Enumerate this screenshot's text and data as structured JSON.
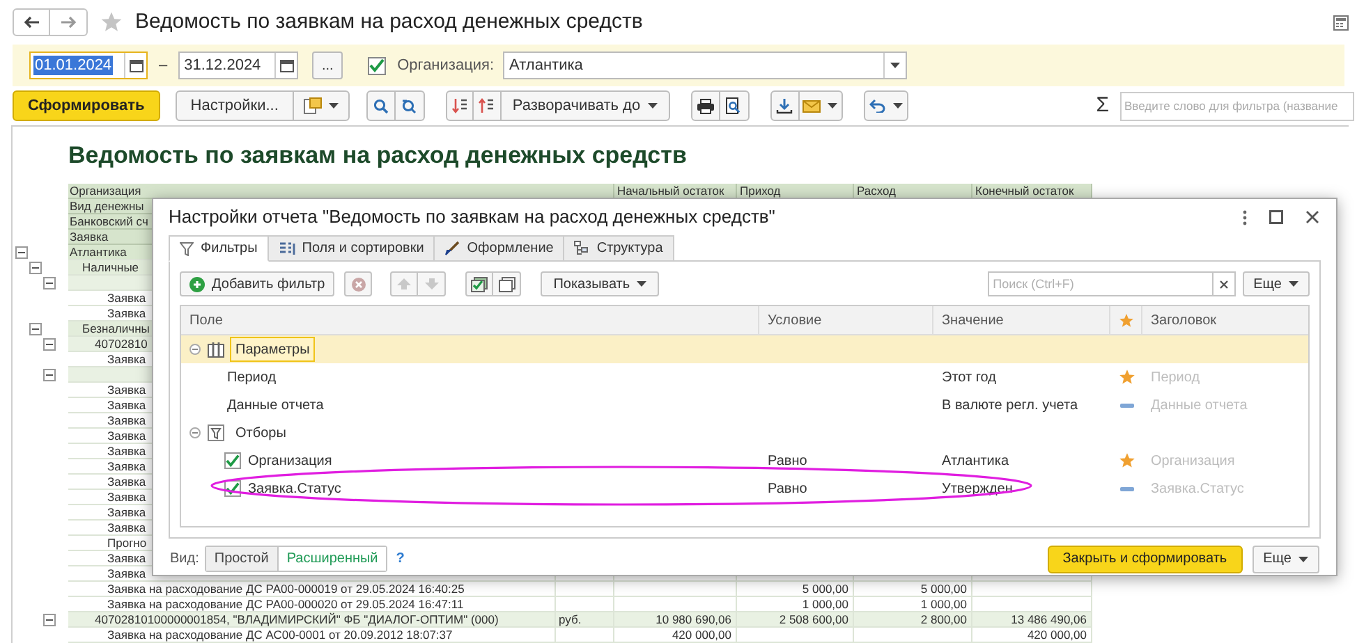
{
  "window": {
    "title": "Ведомость по заявкам на расход денежных средств"
  },
  "period": {
    "start": "01.01.2024",
    "separator": "–",
    "end": "31.12.2024",
    "select_button": "..."
  },
  "organization": {
    "checked": true,
    "label": "Организация:",
    "value": "Атлантика"
  },
  "toolbar": {
    "generate": "Сформировать",
    "settings": "Настройки...",
    "expand": "Разворачивать до",
    "sum": "Σ",
    "search_placeholder": "Введите слово для фильтра (название"
  },
  "report": {
    "title": "Ведомость по заявкам на расход денежных средств",
    "header_rows": [
      "Организация",
      "Вид денежны",
      "Банковский сч",
      "Заявка"
    ],
    "columns": [
      "Начальный остаток",
      "Приход",
      "Расход",
      "Конечный остаток"
    ],
    "rows": [
      {
        "label": "Атлантика",
        "expanded": true,
        "children": [
          {
            "label": "Наличные",
            "expanded": true,
            "children": [
              {
                "expanded": true,
                "children": [
                  {
                    "label": "Заявка"
                  },
                  {
                    "label": "Заявка"
                  }
                ]
              }
            ]
          },
          {
            "label": "Безналичны",
            "expanded": true,
            "children": [
              {
                "label": "40702810",
                "expanded": true,
                "children": [
                  {
                    "label": "Заявка"
                  }
                ]
              },
              {
                "expanded": true,
                "children": [
                  {
                    "label": "Заявка"
                  },
                  {
                    "label": "Заявка"
                  },
                  {
                    "label": "Заявка"
                  },
                  {
                    "label": "Заявка"
                  },
                  {
                    "label": "Заявка"
                  },
                  {
                    "label": "Заявка"
                  },
                  {
                    "label": "Заявка"
                  },
                  {
                    "label": "Заявка"
                  },
                  {
                    "label": "Заявка"
                  },
                  {
                    "label": "Заявка"
                  },
                  {
                    "label": "Прогно"
                  },
                  {
                    "label": "Заявка"
                  },
                  {
                    "label": "Заявка"
                  },
                  {
                    "label": "Заявка на расходование ДС РА00-000019 от 29.05.2024 16:40:25",
                    "values": {
                      "income": "5 000,00",
                      "expense": "5 000,00"
                    }
                  },
                  {
                    "label": "Заявка на расходование ДС РА00-000020 от 29.05.2024 16:47:11",
                    "values": {
                      "income": "1 000,00",
                      "expense": "1 000,00"
                    }
                  }
                ]
              },
              {
                "label": "40702810100000001854, \"ВЛАДИМИРСКИЙ\" ФБ \"ДИАЛОГ-ОПТИМ\" (000)",
                "expanded": true,
                "values": {
                  "unit": "руб.",
                  "opening": "10 980 690,06",
                  "income": "2 508 600,00",
                  "expense": "2 800,00",
                  "closing": "13 486 490,06"
                },
                "children": [
                  {
                    "label": "Заявка на расходование ДС АС00-0001 от 20.09.2012 18:07:37",
                    "values": {
                      "opening": "420 000,00",
                      "closing": "420 000,00"
                    }
                  }
                ]
              }
            ]
          }
        ]
      }
    ]
  },
  "settings_dialog": {
    "title": "Настройки отчета \"Ведомость по заявкам на расход денежных средств\"",
    "tabs": [
      {
        "label": "Фильтры",
        "selected": true
      },
      {
        "label": "Поля и сортировки",
        "selected": false
      },
      {
        "label": "Оформление",
        "selected": false
      },
      {
        "label": "Структура",
        "selected": false
      }
    ],
    "add_filter": "Добавить фильтр",
    "show": "Показывать",
    "search_placeholder": "Поиск (Ctrl+F)",
    "more": "Еще",
    "columns": {
      "field": "Поле",
      "condition": "Условие",
      "value": "Значение",
      "title": "Заголовок"
    },
    "rows": [
      {
        "kind": "parameters",
        "label": "Параметры",
        "expanded": true,
        "selected": true,
        "children": [
          {
            "kind": "parameter",
            "label": "Период",
            "value": "Этот год",
            "quick": true,
            "title": "Период",
            "selected": false
          },
          {
            "kind": "parameter",
            "label": "Данные отчета",
            "value": "В валюте регл. учета",
            "quick": false,
            "title": "Данные отчета",
            "selected": false
          }
        ]
      },
      {
        "kind": "filters",
        "label": "Отборы",
        "expanded": true,
        "selected": false,
        "children": [
          {
            "kind": "filter",
            "label": "Организация",
            "checked": true,
            "condition": "Равно",
            "value": "Атлантика",
            "quick": true,
            "title": "Организация",
            "selected": false
          },
          {
            "kind": "filter",
            "label": "Заявка.Статус",
            "checked": true,
            "condition": "Равно",
            "value": "Утвержден",
            "quick": false,
            "title": "Заявка.Статус",
            "selected": false
          }
        ]
      }
    ],
    "view": {
      "label": "Вид:",
      "modes": [
        {
          "label": "Простой",
          "selected": false
        },
        {
          "label": "Расширенный",
          "selected": true
        }
      ],
      "help": "?"
    },
    "close_button": "Закрыть и сформировать",
    "footer_more": "Еще"
  }
}
